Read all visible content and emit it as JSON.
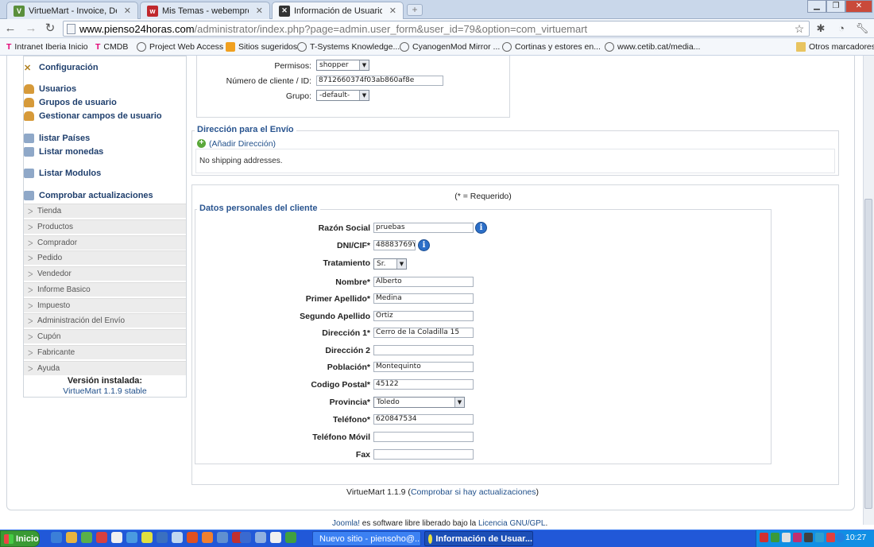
{
  "browser": {
    "tabs": [
      {
        "title": "VirtueMart - Invoice, Delivery N",
        "active": false,
        "color": "#5a8f3c"
      },
      {
        "title": "Mis Temas - webempresa joom",
        "active": false,
        "color": "#c0282d"
      },
      {
        "title": "Información de Usuario",
        "active": true,
        "color": "#333333"
      }
    ],
    "url_host": "www.pienso24horas.com",
    "url_path": "/administrator/index.php?page=admin.user_form&user_id=79&option=com_virtuemart",
    "bookmarks": [
      "Intranet Iberia Inicio",
      "CMDB",
      "Project Web Access",
      "Sitios sugeridos",
      "T-Systems Knowledge...",
      "CyanogenMod Mirror ...",
      "Cortinas y estores en...",
      "www.cetib.cat/media..."
    ],
    "other_bookmarks": "Otros marcadores"
  },
  "sidebar": {
    "links": [
      "Configuración",
      "Usuarios",
      "Grupos de usuario",
      "Gestionar campos de usuario",
      "listar Países",
      "Listar monedas",
      "Listar Modulos",
      "Comprobar actualizaciones"
    ],
    "sections": [
      "Tienda",
      "Productos",
      "Comprador",
      "Pedido",
      "Vendedor",
      "Informe Basico",
      "Impuesto",
      "Administración del Envío",
      "Cupón",
      "Fabricante",
      "Ayuda"
    ],
    "version_label": "Versión instalada:",
    "version_value": "VirtueMart 1.1.9 stable"
  },
  "account": {
    "permisos_label": "Permisos:",
    "permisos_value": "shopper",
    "cliente_label": "Número de cliente / ID:",
    "cliente_value": "8712660374f03ab860af8e",
    "grupo_label": "Grupo:",
    "grupo_value": "-default-"
  },
  "shipping": {
    "legend": "Dirección para el Envío",
    "add_link": "(Añadir Dirección)",
    "empty": "No shipping addresses."
  },
  "personal": {
    "required_note": "(* = Requerido)",
    "legend": "Datos personales del cliente",
    "fields": {
      "razon_label": "Razón Social",
      "razon_value": "pruebas",
      "dni_label": "DNI/CIF*",
      "dni_value": "48883769Y",
      "tratamiento_label": "Tratamiento",
      "tratamiento_value": "Sr.",
      "nombre_label": "Nombre*",
      "nombre_value": "Alberto",
      "apellido1_label": "Primer Apellido*",
      "apellido1_value": "Medina",
      "apellido2_label": "Segundo Apellido",
      "apellido2_value": "Ortiz",
      "dir1_label": "Dirección 1*",
      "dir1_value": "Cerro de la Coladilla 15",
      "dir2_label": "Dirección 2",
      "dir2_value": "",
      "poblacion_label": "Población*",
      "poblacion_value": "Montequinto",
      "cp_label": "Codigo Postal*",
      "cp_value": "45122",
      "provincia_label": "Provincia*",
      "provincia_value": "Toledo",
      "telefono_label": "Teléfono*",
      "telefono_value": "620847534",
      "movil_label": "Teléfono Móvil",
      "movil_value": "",
      "fax_label": "Fax",
      "fax_value": ""
    }
  },
  "footer": {
    "vm_version": "VirtueMart 1.1.9 (",
    "vm_link": "Comprobar si hay actualizaciones",
    "vm_close": ")",
    "joomla": "Joomla!",
    "joomla_text": " es software libre liberado bajo la ",
    "licencia": "Licencia GNU/GPL",
    "dot": "."
  },
  "taskbar": {
    "start": "Inicio",
    "windows": [
      {
        "title": "Nuevo sitio - piensoho@...",
        "active": false
      },
      {
        "title": "Información de Usuar...",
        "active": true
      }
    ],
    "clock": "10:27"
  }
}
